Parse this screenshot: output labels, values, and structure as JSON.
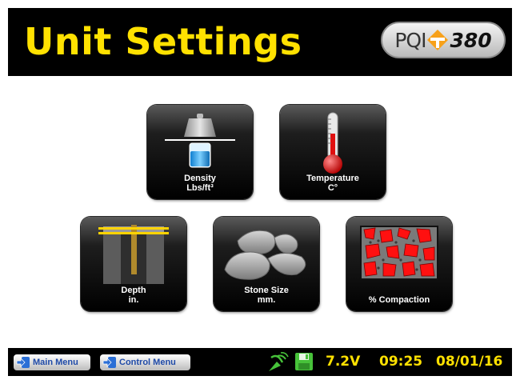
{
  "header": {
    "title": "Unit Settings",
    "logo_text": "PQI",
    "logo_model": "380"
  },
  "tiles": {
    "density": {
      "line1": "Density",
      "line2": "Lbs/ft³"
    },
    "temperature": {
      "line1": "Temperature",
      "line2": "C°"
    },
    "depth": {
      "line1": "Depth",
      "line2": "in."
    },
    "stone_size": {
      "line1": "Stone Size",
      "line2": "mm."
    },
    "compaction": {
      "line1": "% Compaction"
    }
  },
  "footer": {
    "main_menu": "Main Menu",
    "control_menu": "Control Menu",
    "voltage": "7.2V",
    "time": "09:25",
    "date": "08/01/16"
  },
  "colors": {
    "title": "#ffe100",
    "status": "#ffe100",
    "link": "#1f4aa8",
    "accent_orange": "#f7a11a"
  }
}
